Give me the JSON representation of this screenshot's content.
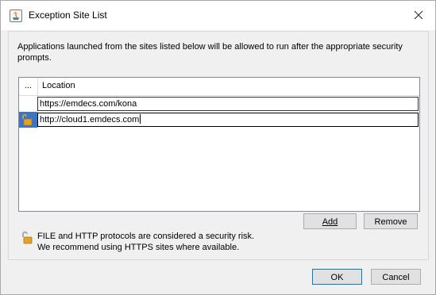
{
  "window": {
    "title": "Exception Site List",
    "close_label": "×"
  },
  "description": "Applications launched from the sites listed below will be allowed to run after the appropriate security prompts.",
  "table": {
    "columns": [
      "...",
      "Location"
    ],
    "rows": [
      {
        "location": "https://emdecs.com/kona",
        "selected": false,
        "icon": ""
      },
      {
        "location": "http://cloud1.emdecs.com",
        "selected": true,
        "icon": "unlocked-padlock-icon"
      }
    ]
  },
  "buttons": {
    "add_label": "Add",
    "remove_label": "Remove",
    "ok_label": "OK",
    "cancel_label": "Cancel"
  },
  "warning": {
    "line1": "FILE and HTTP protocols are considered a security risk.",
    "line2": "We recommend using HTTPS sites where available.",
    "icon": "unlocked-padlock-icon"
  },
  "colors": {
    "selection": "#3a76c5",
    "padlock": "#e3a32b",
    "default_button_border": "#0078d7"
  }
}
